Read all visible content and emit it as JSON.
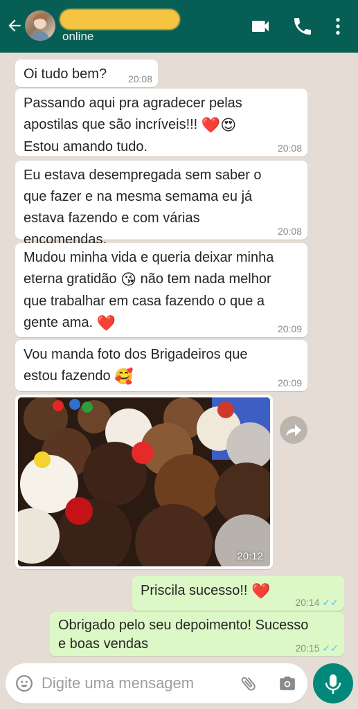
{
  "header": {
    "contact_name": "",
    "status": "online"
  },
  "messages": [
    {
      "text": "Oi tudo bem?",
      "time": "20:08",
      "direction": "in"
    },
    {
      "lines": [
        "Passando aqui pra agradecer pelas",
        "apostilas que são incríveis!!!",
        "Estou amando tudo."
      ],
      "emoji": [
        "❤️",
        "😍"
      ],
      "time": "20:08",
      "direction": "in"
    },
    {
      "lines": [
        "Eu estava desempregada sem saber o",
        "que fazer e na mesma semama eu já",
        "estava fazendo e com várias",
        "encomendas."
      ],
      "time": "20:08",
      "direction": "in"
    },
    {
      "lines": [
        "Mudou minha vida e queria deixar minha",
        "eterna gratidão",
        "não tem nada melhor",
        "que trabalhar em casa fazendo o que a",
        "gente ama."
      ],
      "emoji": [
        "😘",
        "❤️"
      ],
      "time": "20:09",
      "direction": "in"
    },
    {
      "lines": [
        "Vou manda foto dos Brigadeiros que",
        "estou fazendo"
      ],
      "emoji": [
        "🥰"
      ],
      "time": "20:09",
      "direction": "in"
    },
    {
      "type": "photo",
      "caption_alt": "brigadeiros",
      "time": "20:12",
      "direction": "in"
    },
    {
      "text": "Priscila sucesso!!",
      "emoji": [
        "❤️"
      ],
      "time": "20:14",
      "direction": "out",
      "ticks": "✓✓"
    },
    {
      "lines": [
        "Obrigado pelo seu depoimento! Sucesso",
        "e boas vendas"
      ],
      "time": "20:15",
      "direction": "out",
      "ticks": "✓✓"
    }
  ],
  "composer": {
    "placeholder": "Digite uma mensagem"
  },
  "colors": {
    "header": "#075e54",
    "outgoing": "#dcf8c6",
    "chat_bg": "#e5ddd5",
    "mic": "#00897b",
    "read_ticks": "#4fc3f7"
  },
  "icons": [
    "back-arrow-icon",
    "video-call-icon",
    "phone-icon",
    "menu-dots-icon",
    "forward-icon",
    "emoji-icon",
    "attach-icon",
    "camera-icon",
    "mic-icon"
  ]
}
